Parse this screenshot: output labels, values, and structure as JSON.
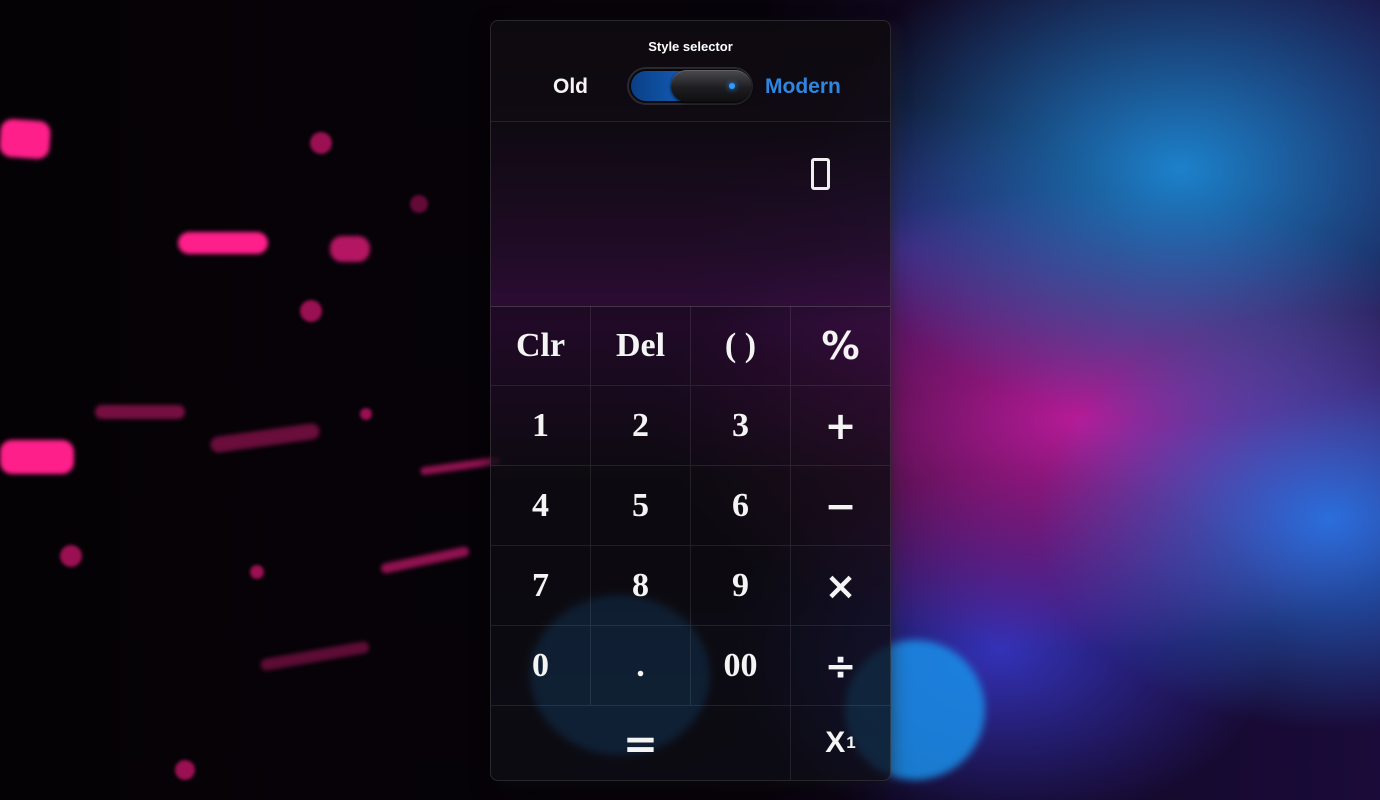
{
  "style_selector": {
    "title": "Style selector",
    "option_old": "Old",
    "option_modern": "Modern",
    "selected": "Modern"
  },
  "display": {
    "value": "0"
  },
  "keys": {
    "row1": [
      "Clr",
      "Del",
      "( )",
      "%"
    ],
    "row2": [
      "1",
      "2",
      "3",
      "+"
    ],
    "row3": [
      "4",
      "5",
      "6",
      "−"
    ],
    "row4": [
      "7",
      "8",
      "9",
      "×"
    ],
    "row5": [
      "0",
      ".",
      "00",
      "÷"
    ],
    "equals": "=",
    "power_base": "X",
    "power_exp": "1"
  },
  "colors": {
    "accent": "#2f86e0",
    "text": "#f4f4f4"
  }
}
